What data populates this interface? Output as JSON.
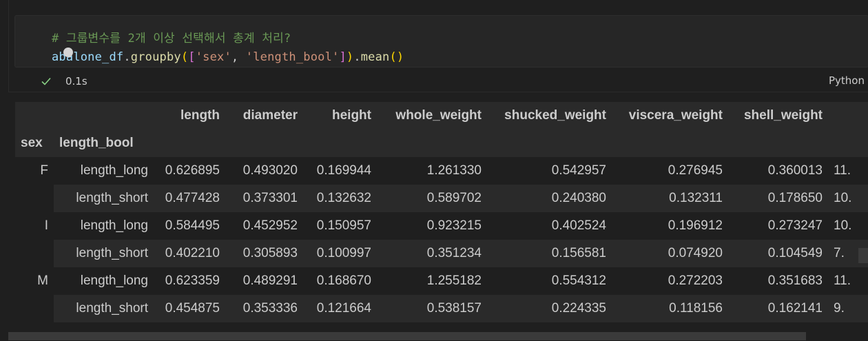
{
  "cell": {
    "comment": "# 그룹변수를 2개 이상 선택해서 총계 처리?",
    "code": {
      "var": "abalone_df",
      "dot1": ".",
      "fn": "groupby",
      "open_paren": "(",
      "open_bracket": "[",
      "str1": "'sex'",
      "comma": ", ",
      "str2": "'length_bool'",
      "close_bracket": "]",
      "close_paren": ")",
      "dot2": ".",
      "fn2": "mean",
      "call": "()"
    },
    "exec_time": "0.1s",
    "language": "Python",
    "status_color": "#89d185"
  },
  "dataframe": {
    "columns": [
      "length",
      "diameter",
      "height",
      "whole_weight",
      "shucked_weight",
      "viscera_weight",
      "shell_weight",
      ""
    ],
    "index_names": [
      "sex",
      "length_bool"
    ],
    "rows": [
      {
        "sex": "F",
        "length_bool": "length_long",
        "values": [
          "0.626895",
          "0.493020",
          "0.169944",
          "1.261330",
          "0.542957",
          "0.276945",
          "0.360013",
          "11."
        ]
      },
      {
        "sex": "",
        "length_bool": "length_short",
        "values": [
          "0.477428",
          "0.373301",
          "0.132632",
          "0.589702",
          "0.240380",
          "0.132311",
          "0.178650",
          "10."
        ]
      },
      {
        "sex": "I",
        "length_bool": "length_long",
        "values": [
          "0.584495",
          "0.452952",
          "0.150957",
          "0.923215",
          "0.402524",
          "0.196912",
          "0.273247",
          "10."
        ]
      },
      {
        "sex": "",
        "length_bool": "length_short",
        "values": [
          "0.402210",
          "0.305893",
          "0.100997",
          "0.351234",
          "0.156581",
          "0.074920",
          "0.104549",
          "7."
        ]
      },
      {
        "sex": "M",
        "length_bool": "length_long",
        "values": [
          "0.623359",
          "0.489291",
          "0.168670",
          "1.255182",
          "0.554312",
          "0.272203",
          "0.351683",
          "11."
        ]
      },
      {
        "sex": "",
        "length_bool": "length_short",
        "values": [
          "0.454875",
          "0.353336",
          "0.121664",
          "0.538157",
          "0.224335",
          "0.118156",
          "0.162141",
          "9."
        ]
      }
    ]
  }
}
